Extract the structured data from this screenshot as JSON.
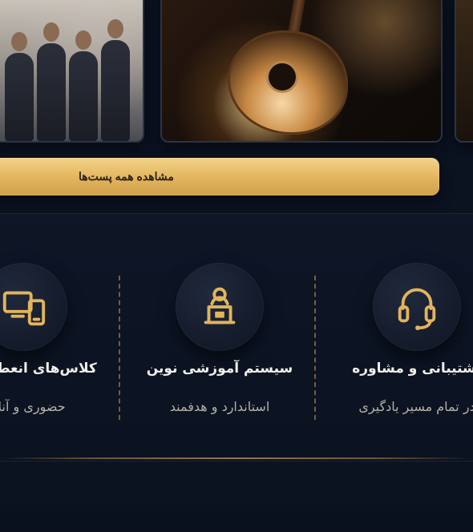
{
  "cta": {
    "label": "مشاهده همه پست‌ها"
  },
  "features": [
    {
      "icon": "headset-icon",
      "title": "پشتیبانی و مشاوره",
      "subtitle": "در تمام مسیر یادگیری"
    },
    {
      "icon": "teacher-board-icon",
      "title": "سیستم آموزشی نوین",
      "subtitle": "استاندارد و هدفمند"
    },
    {
      "icon": "devices-icon",
      "title": "کلاس‌های انعطاف‌پذیر",
      "subtitle": "حضوری و آنلاین"
    }
  ],
  "colors": {
    "background": "#0b1220",
    "gold": "#e2b45c",
    "panel": "#0e1627",
    "text": "#f1efe9",
    "muted": "#b5b1a8"
  }
}
